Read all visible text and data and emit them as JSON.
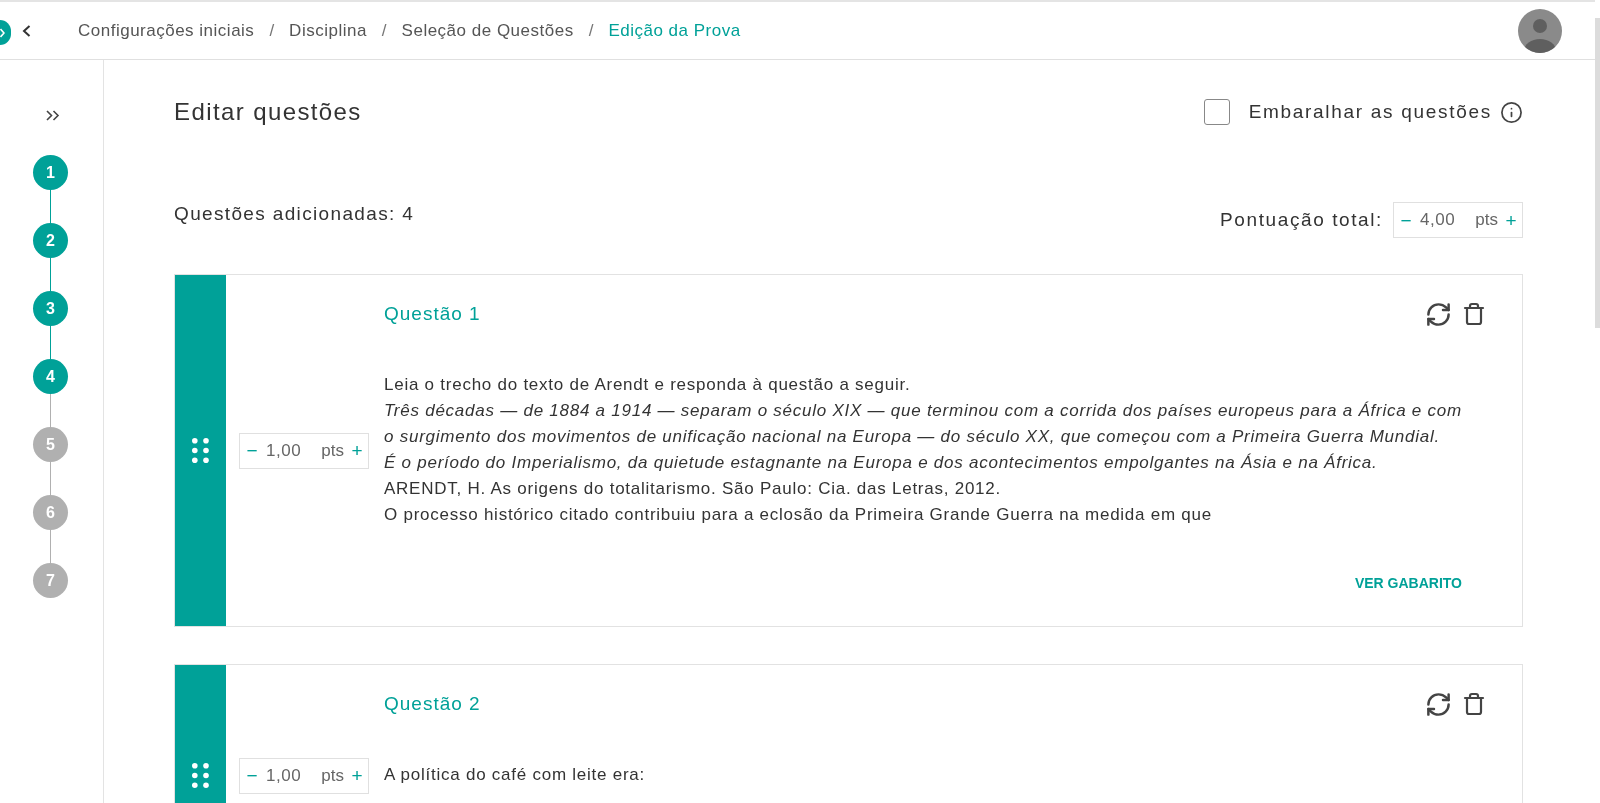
{
  "header": {
    "breadcrumbs": [
      {
        "label": "Configurações iniciais",
        "current": false,
        "separator": "/"
      },
      {
        "label": "Disciplina",
        "current": false,
        "separator": "/"
      },
      {
        "label": "Seleção de Questões",
        "current": false,
        "separator": "/"
      },
      {
        "label": "Edição da Prova",
        "current": true
      }
    ]
  },
  "steps": [
    {
      "label": "1",
      "completed": true
    },
    {
      "label": "2",
      "completed": true
    },
    {
      "label": "3",
      "completed": true
    },
    {
      "label": "4",
      "completed": true
    },
    {
      "label": "5",
      "completed": false
    },
    {
      "label": "6",
      "completed": false
    },
    {
      "label": "7",
      "completed": false
    }
  ],
  "page": {
    "title": "Editar questões",
    "shuffle": {
      "label": "Embaralhar as questões",
      "checked": false
    },
    "added_count": "Questões adicionadas: 4",
    "total_score": {
      "label": "Pontuação total:",
      "decrement": "−",
      "value": "4,00",
      "unit": "pts",
      "increment": "+"
    }
  },
  "questions": [
    {
      "title": "Questão 1",
      "points": {
        "decrement": "−",
        "value": "1,00",
        "unit": "pts",
        "increment": "+"
      },
      "paragraphs": [
        {
          "kind": "text",
          "lines": [
            "Leia o trecho do texto de Arendt e responda à questão a seguir."
          ]
        },
        {
          "kind": "quote",
          "lines": [
            "Três décadas — de 1884 a 1914 — separam o século XIX — que terminou com a corrida dos países europeus para a África e com",
            "o surgimento dos movimentos de unificação nacional na Europa — do século XX, que começou com a Primeira Guerra Mundial.",
            "É o período do Imperialismo, da quietude estagnante na Europa e dos acontecimentos empolgantes na Ásia e na África."
          ]
        },
        {
          "kind": "text",
          "lines": [
            "ARENDT, H. As origens do totalitarismo. São Paulo: Cia. das Letras, 2012."
          ]
        },
        {
          "kind": "text",
          "lines": [
            "O processo histórico citado contribuiu para a eclosão da Primeira Grande Guerra na medida em que"
          ]
        }
      ],
      "answer_button": "VER GABARITO"
    },
    {
      "title": "Questão 2",
      "points": {
        "decrement": "−",
        "value": "1,00",
        "unit": "pts",
        "increment": "+"
      },
      "paragraphs": [
        {
          "kind": "text",
          "lines": [
            "A política do café com leite era:"
          ]
        }
      ]
    }
  ]
}
